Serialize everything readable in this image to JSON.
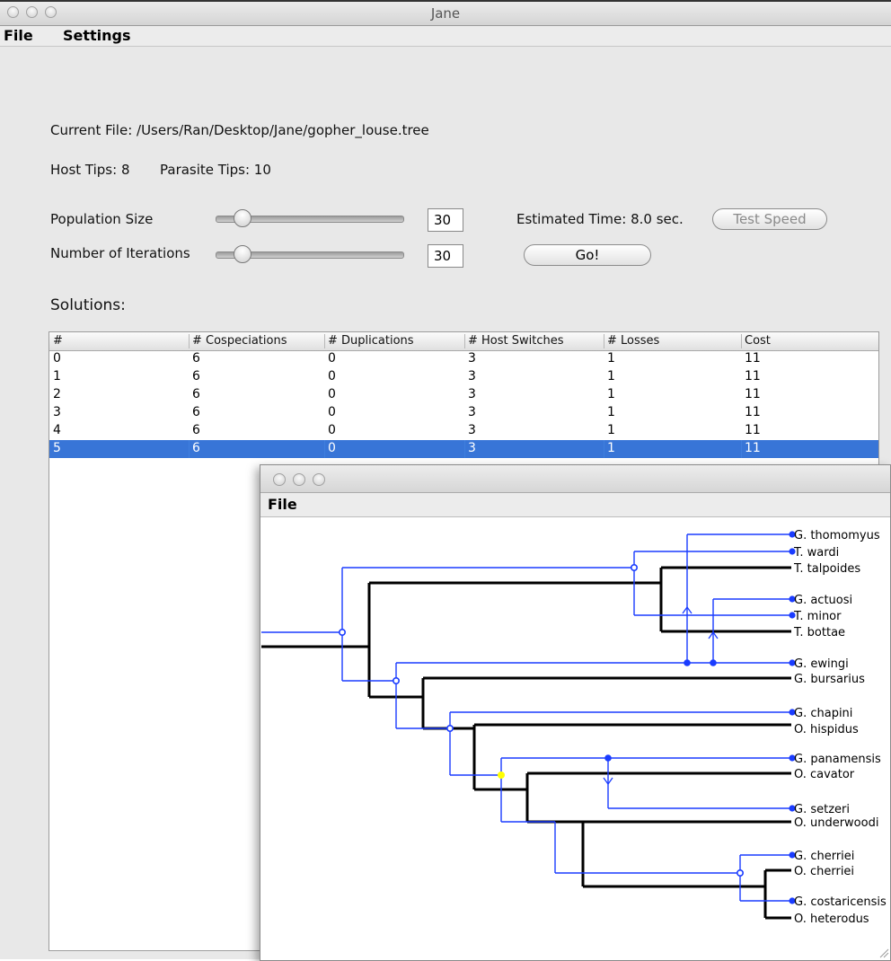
{
  "window": {
    "title": "Jane"
  },
  "menu": {
    "file": "File",
    "settings": "Settings"
  },
  "info": {
    "current_file": "Current File: /Users/Ran/Desktop/Jane/gopher_louse.tree",
    "host_tips": "Host Tips: 8",
    "parasite_tips": "Parasite Tips: 10"
  },
  "controls": {
    "population_label": "Population Size",
    "population_value": "30",
    "iterations_label": "Number of Iterations",
    "iterations_value": "30",
    "estimated_time": "Estimated Time: 8.0 sec.",
    "test_speed": "Test Speed",
    "go": "Go!"
  },
  "solutions": {
    "label": "Solutions:",
    "columns": [
      "#",
      "# Cospeciations",
      "# Duplications",
      "# Host Switches",
      "# Losses",
      "Cost"
    ],
    "rows": [
      [
        "0",
        "6",
        "0",
        "3",
        "1",
        "11"
      ],
      [
        "1",
        "6",
        "0",
        "3",
        "1",
        "11"
      ],
      [
        "2",
        "6",
        "0",
        "3",
        "1",
        "11"
      ],
      [
        "3",
        "6",
        "0",
        "3",
        "1",
        "11"
      ],
      [
        "4",
        "6",
        "0",
        "3",
        "1",
        "11"
      ],
      [
        "5",
        "6",
        "0",
        "3",
        "1",
        "11"
      ]
    ],
    "selected_row": 5
  },
  "tree_window": {
    "menu_file": "File",
    "tips": [
      "G. thomomyus",
      "T. wardi",
      "T. talpoides",
      "G. actuosi",
      "T. minor",
      "T. bottae",
      "G. ewingi",
      "G. bursarius",
      "G. chapini",
      "O. hispidus",
      "G. panamensis",
      "O. cavator",
      "G. setzeri",
      "O. underwoodi",
      "G. cherriei",
      "O. cherriei",
      "G. costaricensis",
      "O. heterodus"
    ],
    "colors": {
      "host": "#000000",
      "parasite": "#1a3cff",
      "failure_node": "#ffff00",
      "selection": "#3875d7"
    }
  }
}
